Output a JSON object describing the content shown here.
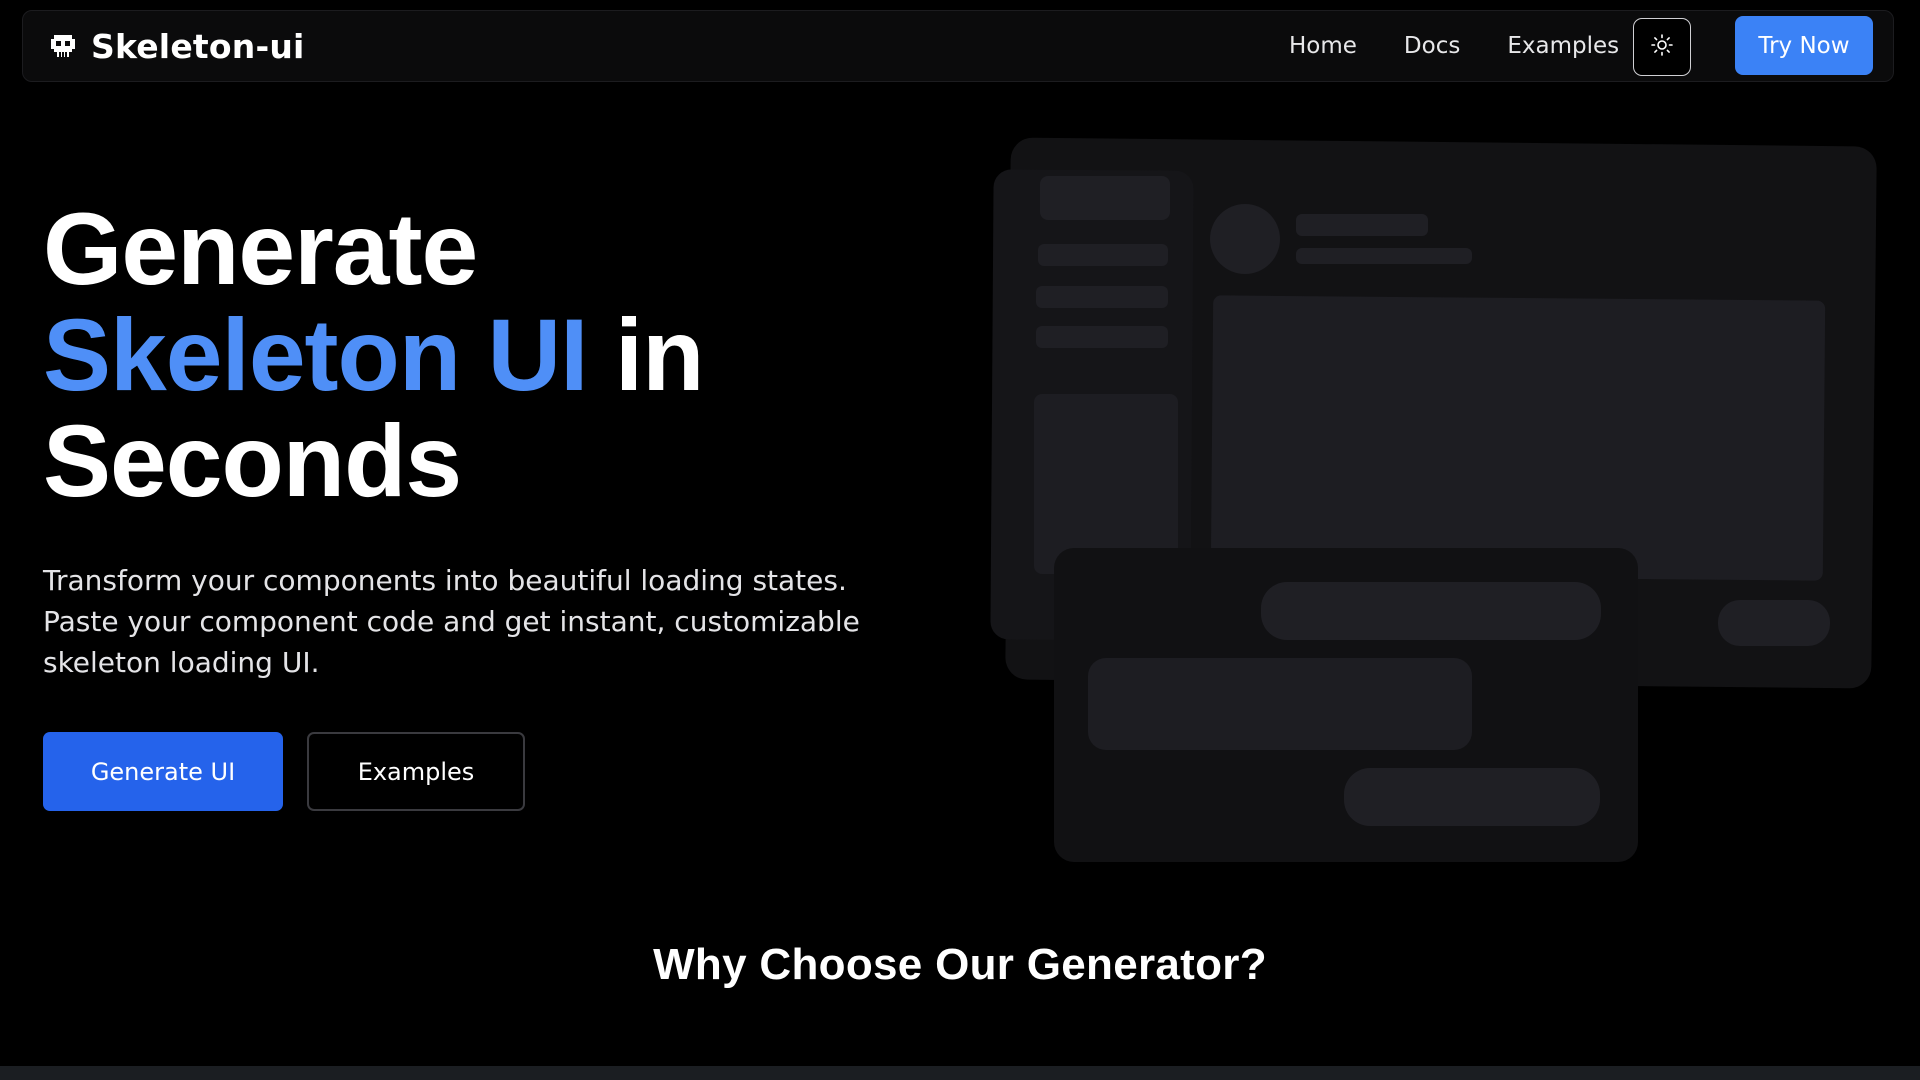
{
  "brand": {
    "name": "Skeleton-ui",
    "icon": "skull-icon"
  },
  "nav": {
    "links": [
      "Home",
      "Docs",
      "Examples"
    ],
    "theme_toggle_icon": "sun-icon",
    "cta_label": "Try Now"
  },
  "hero": {
    "title_line1": "Generate",
    "title_accent": "Skeleton UI",
    "title_after_accent": " in",
    "title_line3": "Seconds",
    "description_line1": "Transform your components into beautiful loading states.",
    "description_line2": "Paste your component code and get instant, customizable",
    "description_line3": "skeleton loading UI.",
    "primary_button": "Generate UI",
    "secondary_button": "Examples"
  },
  "section": {
    "heading": "Why Choose Our Generator?"
  },
  "colors": {
    "background": "#000000",
    "accent": "#4f8ff7",
    "primary_button": "#2563eb",
    "cta_button": "#3b82f6"
  }
}
